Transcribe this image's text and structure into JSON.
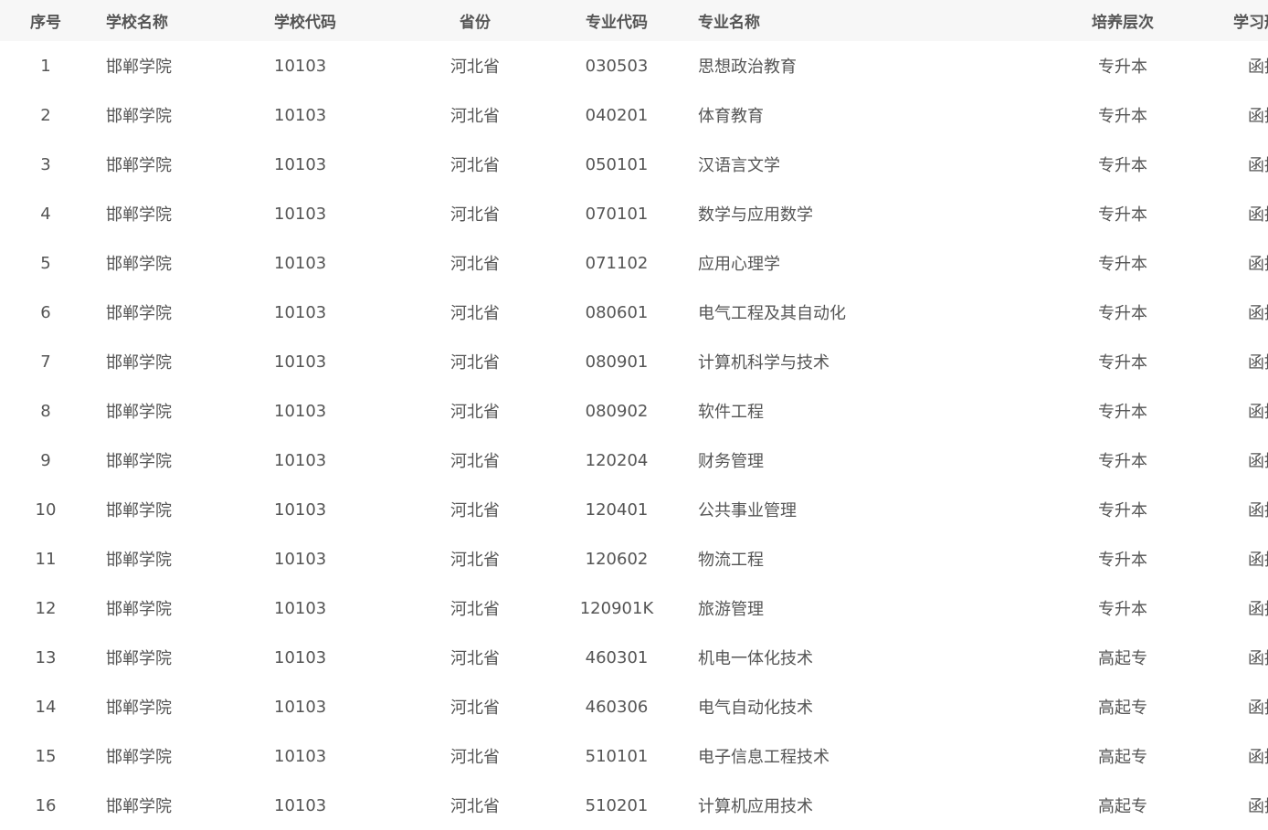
{
  "headers": {
    "seq": "序号",
    "school_name": "学校名称",
    "school_code": "学校代码",
    "province": "省份",
    "major_code": "专业代码",
    "major_name": "专业名称",
    "level": "培养层次",
    "study_mode": "学习形式"
  },
  "rows": [
    {
      "seq": "1",
      "school_name": "邯郸学院",
      "school_code": "10103",
      "province": "河北省",
      "major_code": "030503",
      "major_name": "思想政治教育",
      "level": "专升本",
      "study_mode": "函授"
    },
    {
      "seq": "2",
      "school_name": "邯郸学院",
      "school_code": "10103",
      "province": "河北省",
      "major_code": "040201",
      "major_name": "体育教育",
      "level": "专升本",
      "study_mode": "函授"
    },
    {
      "seq": "3",
      "school_name": "邯郸学院",
      "school_code": "10103",
      "province": "河北省",
      "major_code": "050101",
      "major_name": "汉语言文学",
      "level": "专升本",
      "study_mode": "函授"
    },
    {
      "seq": "4",
      "school_name": "邯郸学院",
      "school_code": "10103",
      "province": "河北省",
      "major_code": "070101",
      "major_name": "数学与应用数学",
      "level": "专升本",
      "study_mode": "函授"
    },
    {
      "seq": "5",
      "school_name": "邯郸学院",
      "school_code": "10103",
      "province": "河北省",
      "major_code": "071102",
      "major_name": "应用心理学",
      "level": "专升本",
      "study_mode": "函授"
    },
    {
      "seq": "6",
      "school_name": "邯郸学院",
      "school_code": "10103",
      "province": "河北省",
      "major_code": "080601",
      "major_name": "电气工程及其自动化",
      "level": "专升本",
      "study_mode": "函授"
    },
    {
      "seq": "7",
      "school_name": "邯郸学院",
      "school_code": "10103",
      "province": "河北省",
      "major_code": "080901",
      "major_name": "计算机科学与技术",
      "level": "专升本",
      "study_mode": "函授"
    },
    {
      "seq": "8",
      "school_name": "邯郸学院",
      "school_code": "10103",
      "province": "河北省",
      "major_code": "080902",
      "major_name": "软件工程",
      "level": "专升本",
      "study_mode": "函授"
    },
    {
      "seq": "9",
      "school_name": "邯郸学院",
      "school_code": "10103",
      "province": "河北省",
      "major_code": "120204",
      "major_name": "财务管理",
      "level": "专升本",
      "study_mode": "函授"
    },
    {
      "seq": "10",
      "school_name": "邯郸学院",
      "school_code": "10103",
      "province": "河北省",
      "major_code": "120401",
      "major_name": "公共事业管理",
      "level": "专升本",
      "study_mode": "函授"
    },
    {
      "seq": "11",
      "school_name": "邯郸学院",
      "school_code": "10103",
      "province": "河北省",
      "major_code": "120602",
      "major_name": "物流工程",
      "level": "专升本",
      "study_mode": "函授"
    },
    {
      "seq": "12",
      "school_name": "邯郸学院",
      "school_code": "10103",
      "province": "河北省",
      "major_code": "120901K",
      "major_name": "旅游管理",
      "level": "专升本",
      "study_mode": "函授"
    },
    {
      "seq": "13",
      "school_name": "邯郸学院",
      "school_code": "10103",
      "province": "河北省",
      "major_code": "460301",
      "major_name": "机电一体化技术",
      "level": "高起专",
      "study_mode": "函授"
    },
    {
      "seq": "14",
      "school_name": "邯郸学院",
      "school_code": "10103",
      "province": "河北省",
      "major_code": "460306",
      "major_name": "电气自动化技术",
      "level": "高起专",
      "study_mode": "函授"
    },
    {
      "seq": "15",
      "school_name": "邯郸学院",
      "school_code": "10103",
      "province": "河北省",
      "major_code": "510101",
      "major_name": "电子信息工程技术",
      "level": "高起专",
      "study_mode": "函授"
    },
    {
      "seq": "16",
      "school_name": "邯郸学院",
      "school_code": "10103",
      "province": "河北省",
      "major_code": "510201",
      "major_name": "计算机应用技术",
      "level": "高起专",
      "study_mode": "函授"
    }
  ]
}
